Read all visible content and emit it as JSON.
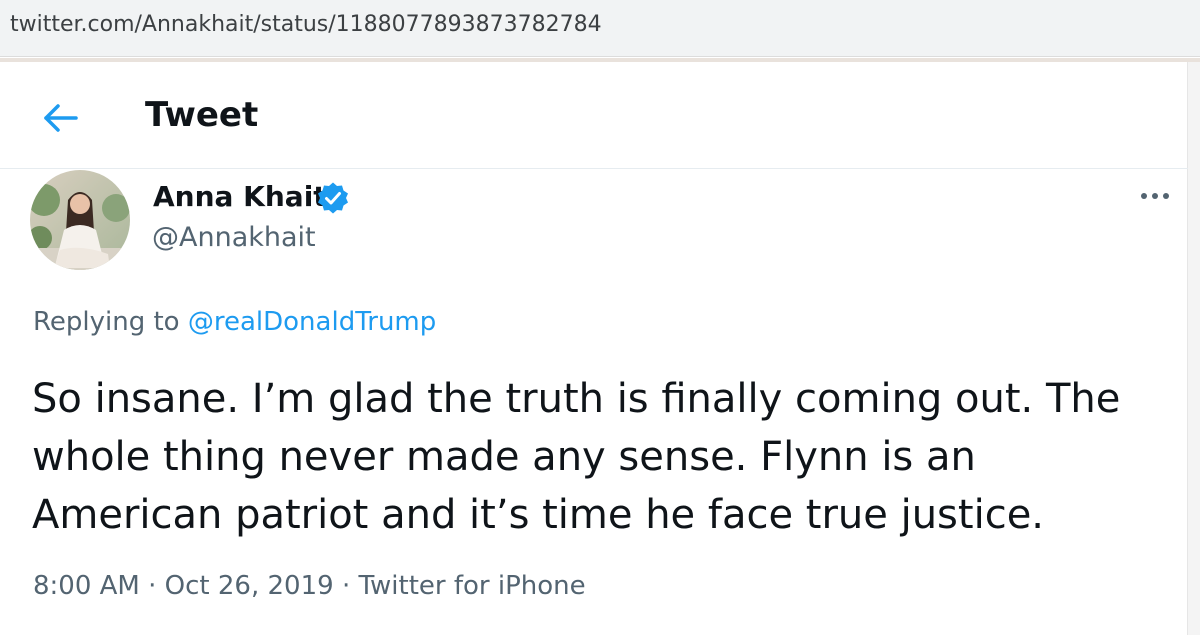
{
  "browser": {
    "url": "twitter.com/Annakhait/status/1188077893873782784"
  },
  "header": {
    "title": "Tweet",
    "back_icon": "back-arrow-icon"
  },
  "tweet": {
    "author": {
      "display_name": "Anna Khait",
      "handle": "@Annakhait",
      "verified": true,
      "avatar": "avatar-photo"
    },
    "replying_label": "Replying to",
    "replying_to": "@realDonaldTrump",
    "text": "So insane. I’m glad the truth is finally coming out. The whole thing never made any sense. Flynn is an American patriot and it’s time he face true justice.",
    "time": "8:00 AM",
    "separator": "·",
    "date": "Oct 26, 2019",
    "source": "Twitter for iPhone",
    "more_icon": "more-options-icon"
  },
  "colors": {
    "accent": "#1d9bf0",
    "secondary_text": "#536471",
    "primary_text": "#0f1419"
  }
}
